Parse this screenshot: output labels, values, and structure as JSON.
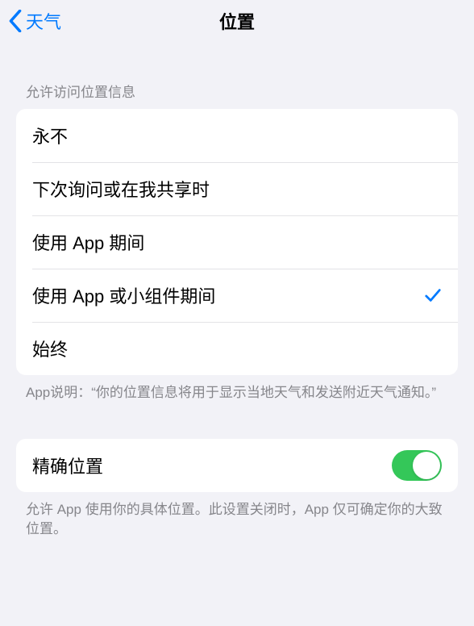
{
  "nav": {
    "back_label": "天气",
    "title": "位置"
  },
  "section1": {
    "header": "允许访问位置信息",
    "options": [
      {
        "label": "永不",
        "selected": false
      },
      {
        "label": "下次询问或在我共享时",
        "selected": false
      },
      {
        "label": "使用 App 期间",
        "selected": false
      },
      {
        "label": "使用 App 或小组件期间",
        "selected": true
      },
      {
        "label": "始终",
        "selected": false
      }
    ],
    "footer": "App说明：“你的位置信息将用于显示当地天气和发送附近天气通知。”"
  },
  "section2": {
    "precise_label": "精确位置",
    "precise_enabled": true,
    "footer": "允许 App 使用你的具体位置。此设置关闭时，App 仅可确定你的大致位置。"
  }
}
